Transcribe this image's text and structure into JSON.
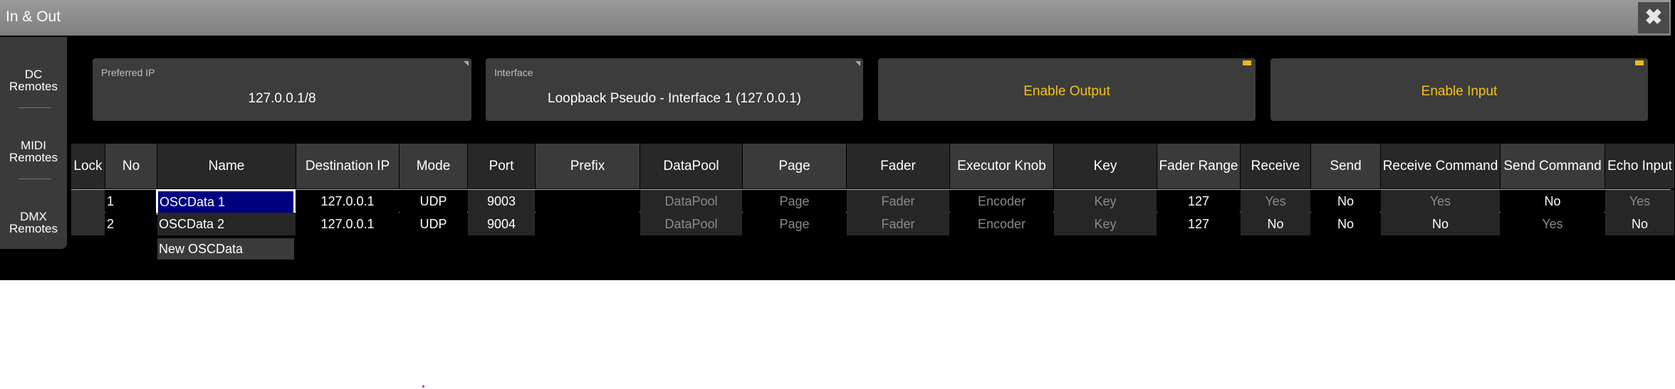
{
  "window": {
    "title": "In & Out",
    "close_icon": "close-icon"
  },
  "sidebar": {
    "items": [
      {
        "label": "DC Remotes"
      },
      {
        "label": "MIDI Remotes"
      },
      {
        "label": "DMX Remotes"
      }
    ]
  },
  "panels": {
    "preferred_ip": {
      "label": "Preferred IP",
      "value": "127.0.0.1/8"
    },
    "interface": {
      "label": "Interface",
      "value": "Loopback Pseudo - Interface 1 (127.0.0.1)"
    },
    "enable_output": "Enable Output",
    "enable_input": "Enable Input"
  },
  "table": {
    "columns": [
      "Lock",
      "No",
      "Name",
      "Destination IP",
      "Mode",
      "Port",
      "Prefix",
      "DataPool",
      "Page",
      "Fader",
      "Executor Knob",
      "Key",
      "Fader Range",
      "Receive",
      "Send",
      "Receive Command",
      "Send Command",
      "Echo Input"
    ],
    "rows": [
      {
        "no": "1",
        "name": "OSCData 1",
        "dest_ip": "127.0.0.1",
        "mode": "UDP",
        "port": "9003",
        "prefix": "",
        "datapool": "DataPool",
        "page": "Page",
        "fader": "Fader",
        "executor_knob": "Encoder",
        "key": "Key",
        "fader_range": "127",
        "receive": "Yes",
        "send": "No",
        "receive_command": "Yes",
        "send_command": "No",
        "echo_input": "Yes",
        "selected": true
      },
      {
        "no": "2",
        "name": "OSCData 2",
        "dest_ip": "127.0.0.1",
        "mode": "UDP",
        "port": "9004",
        "prefix": "",
        "datapool": "DataPool",
        "page": "Page",
        "fader": "Fader",
        "executor_knob": "Encoder",
        "key": "Key",
        "fader_range": "127",
        "receive": "No",
        "send": "No",
        "receive_command": "No",
        "send_command": "Yes",
        "echo_input": "No",
        "selected": false
      }
    ],
    "new_row_label": "New OSCData"
  },
  "colors": {
    "accent": "#f3c21b",
    "selection_bg": "#000080",
    "header_bg": "#3a3a3a"
  }
}
